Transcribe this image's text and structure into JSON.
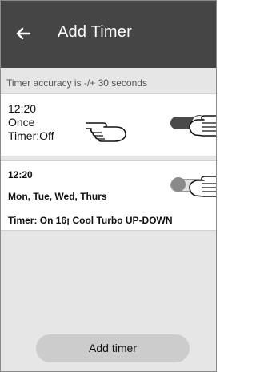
{
  "header": {
    "title": "Add Timer",
    "back_icon": "back-arrow-icon",
    "background": "#454545"
  },
  "note": "Timer accuracy is -/+ 30 seconds",
  "timers": [
    {
      "time": "12:20",
      "repeat": "Once",
      "status": "Timer:Off",
      "enabled": true
    },
    {
      "time": "12:20",
      "repeat": "Mon, Tue, Wed, Thurs",
      "detail": "Timer: On 16¡  Cool   Turbo  UP-DOWN",
      "enabled": false
    }
  ],
  "add_button": {
    "label": "Add timer"
  },
  "icons": {
    "pointer": "hand-pointer-icon"
  }
}
